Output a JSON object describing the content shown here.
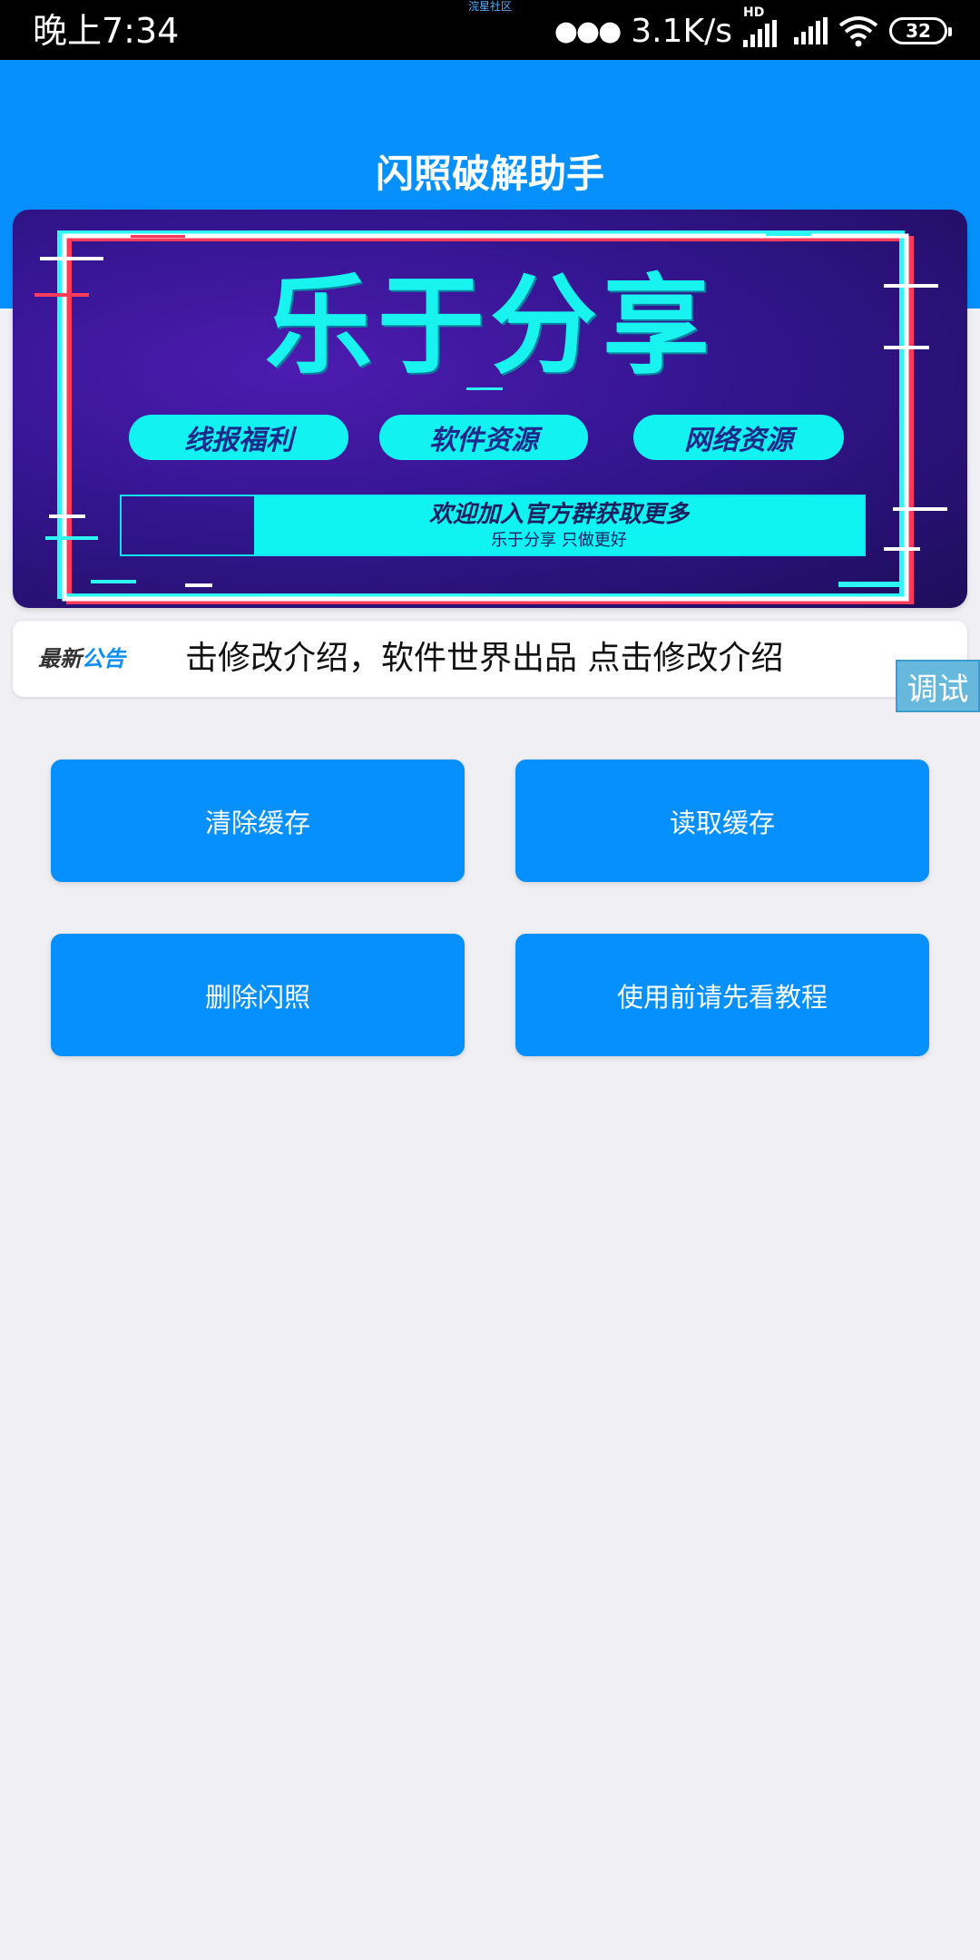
{
  "status_bar": {
    "time": "晚上7:34",
    "watermark": "浣星社区",
    "network_speed": "3.1K/s",
    "hd_label": "HD",
    "battery": "32",
    "icons": [
      "more-dots-icon",
      "signal-icon",
      "wifi-icon",
      "battery-icon"
    ]
  },
  "header": {
    "title": "闪照破解助手"
  },
  "banner": {
    "title": "乐于分享",
    "pills": [
      "线报福利",
      "软件资源",
      "网络资源"
    ],
    "welcome_main": "欢迎加入官方群获取更多",
    "welcome_sub": "乐于分享 只做更好"
  },
  "notice": {
    "label_part1": "最新",
    "label_part2": "公告",
    "text": "击修改介绍，软件世界出品 点击修改介绍"
  },
  "debug_button": "调试",
  "actions": {
    "clear_cache": "清除缓存",
    "read_cache": "读取缓存",
    "delete_flash": "删除闪照",
    "tutorial": "使用前请先看教程"
  },
  "colors": {
    "primary": "#0590fd",
    "banner_accent": "#19f3ef",
    "background": "#efeff4"
  }
}
